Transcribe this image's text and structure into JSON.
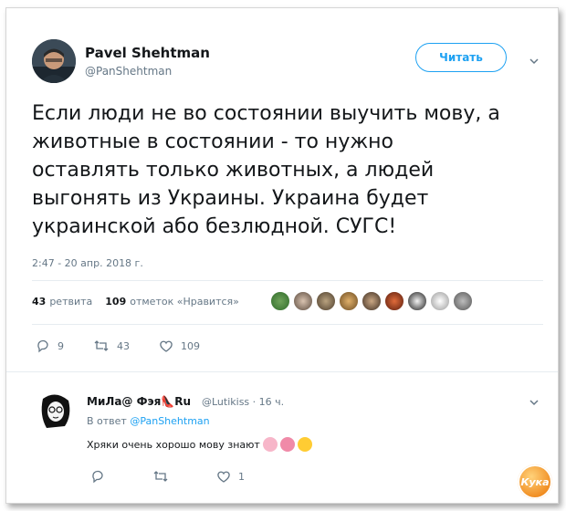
{
  "tweet": {
    "author_name": "Pavel Shehtman",
    "author_handle": "@PanShehtman",
    "follow_label": "Читать",
    "text": "Если люди не во состоянии выучить мову, а\nживотные в состоянии - то нужно\nоставлять только животных, а людей\nвыгонять из Украины. Украина будет\nукраинской або безлюдной. СУГС!",
    "timestamp": "2:47 - 20 апр. 2018 г.",
    "retweets_count": "43",
    "retweets_label": "ретвита",
    "likes_count": "109",
    "likes_label": "отметок «Нравится»",
    "actions": {
      "replies": "9",
      "retweets": "43",
      "likes": "109"
    }
  },
  "reply": {
    "author_name": "МиЛа@ Фэя👠Ru",
    "author_handle": "@Lutikiss · 16 ч.",
    "reply_to_prefix": "В ответ",
    "reply_to_handle": "@PanShehtman",
    "text": "Хряки очень хорошо мову знают",
    "actions": {
      "replies": "",
      "retweets": "",
      "likes": "1"
    }
  },
  "watermark": {
    "text": "Кука"
  },
  "colors": {
    "accent": "#1da1f2",
    "muted": "#657786",
    "text": "#14171a"
  }
}
